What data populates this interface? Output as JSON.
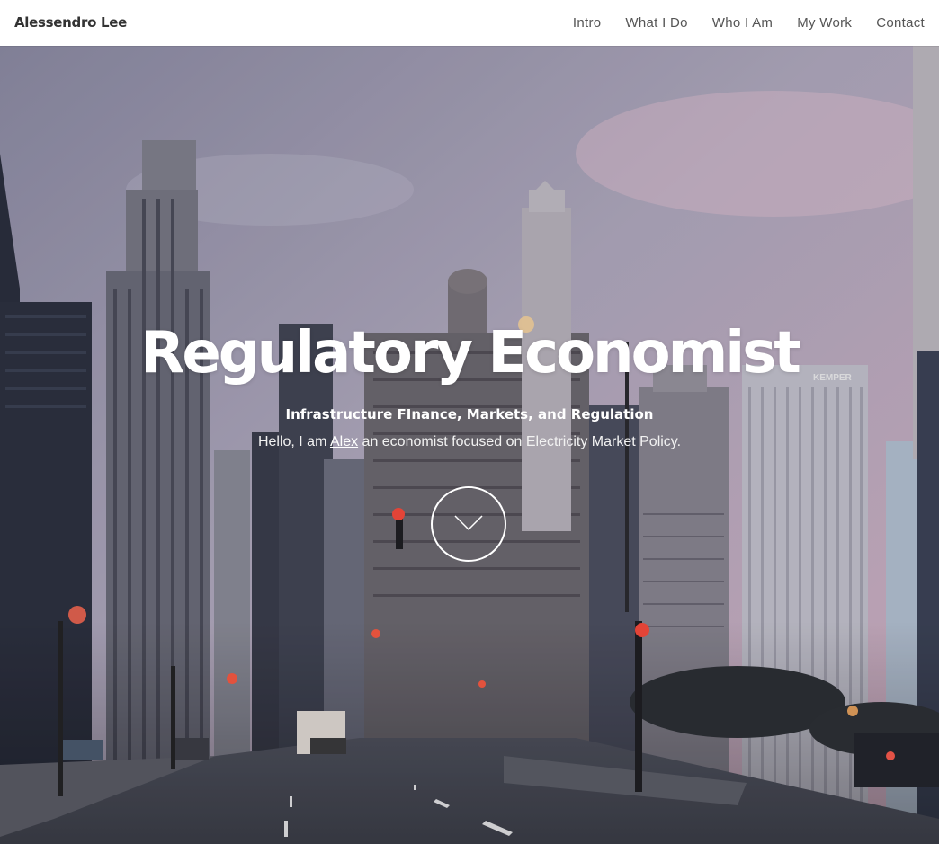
{
  "header": {
    "brand": "Alessendro Lee",
    "nav": [
      {
        "label": "Intro"
      },
      {
        "label": "What I Do"
      },
      {
        "label": "Who I Am"
      },
      {
        "label": "My Work"
      },
      {
        "label": "Contact"
      }
    ]
  },
  "hero": {
    "title": "Regulatory Economist",
    "subtitle": "Infrastructure FInance, Markets, and Regulation",
    "intro_prefix": "Hello, I am ",
    "intro_link": "Alex",
    "intro_suffix": " an economist focused on Electricity Market Policy.",
    "scroll_icon": "chevron-down-icon",
    "background": "city-street-skyline-photo",
    "sign_text": "KEMPER"
  },
  "colors": {
    "header_bg": "#ffffff",
    "brand_text": "#333333",
    "nav_text": "#555555",
    "hero_text": "#ffffff",
    "sky_top": "#9a97ac",
    "sky_pink": "#d6b3c6"
  }
}
